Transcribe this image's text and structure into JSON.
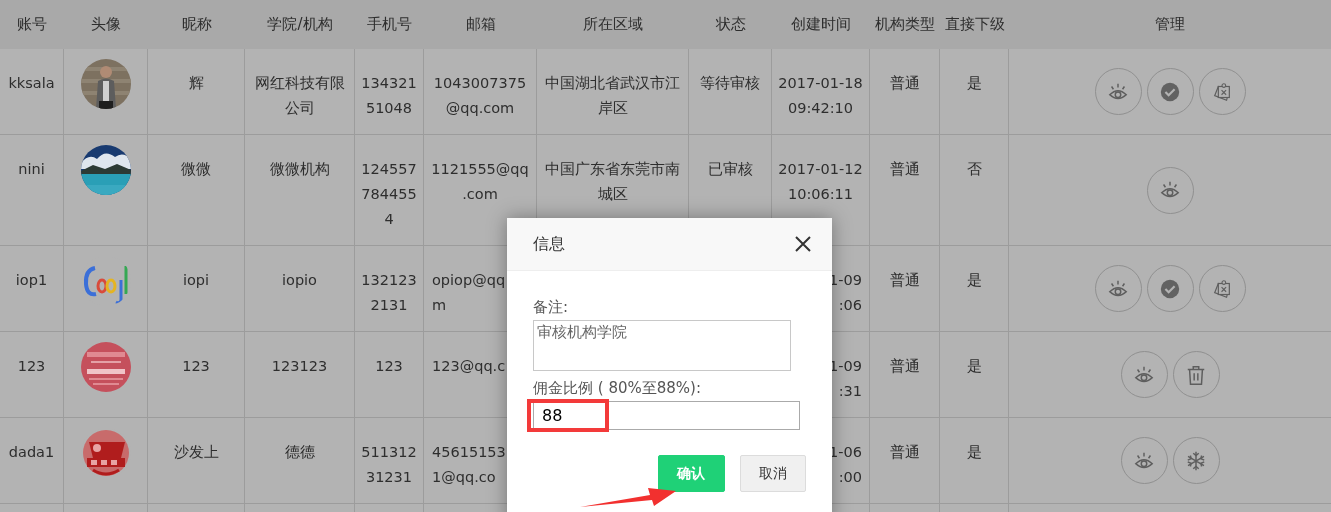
{
  "table": {
    "columns": [
      "账号",
      "头像",
      "昵称",
      "学院/机构",
      "手机号",
      "邮箱",
      "所在区域",
      "状态",
      "创建时间",
      "机构类型",
      "直接下级",
      "管理"
    ],
    "rows": [
      {
        "account": "kksala",
        "avatar": {
          "kind": "picture"
        },
        "nickname": "辉",
        "org": "网红科技有限公司",
        "phone": "134321\n51048",
        "email": "1043007375\n@qq.com",
        "region": "中国湖北省武汉市江岸区",
        "status": "等待审核",
        "created": "2017-01-18\n09:42:10",
        "org_type": "普通",
        "direct_sub": "是",
        "covered": false,
        "actions": [
          {
            "kind": "view"
          },
          {
            "kind": "approve"
          },
          {
            "kind": "reject"
          }
        ]
      },
      {
        "account": "nini",
        "avatar": {
          "kind": "picture"
        },
        "nickname": "微微",
        "org": "微微机构",
        "phone": "124557\n784455\n4",
        "email": "1121555@qq\n.com",
        "region": "中国广东省东莞市南城区",
        "status": "已审核",
        "created": "2017-01-12\n10:06:11",
        "org_type": "普通",
        "direct_sub": "否",
        "covered": false,
        "actions": [
          {
            "kind": "view"
          }
        ]
      },
      {
        "account": "iop1",
        "avatar": {
          "kind": "picture"
        },
        "nickname": "iopi",
        "org": "iopio",
        "phone": "132123\n2131",
        "email": "opiop@qq\nm",
        "created": "1-09\n:06",
        "org_type": "普通",
        "direct_sub": "是",
        "covered": true,
        "actions": [
          {
            "kind": "view"
          },
          {
            "kind": "approve"
          },
          {
            "kind": "reject"
          }
        ]
      },
      {
        "account": "123",
        "avatar": {
          "kind": "picture"
        },
        "nickname": "123",
        "org": "123123",
        "phone": "123",
        "email": "123@qq.c",
        "created": "1-09\n:31",
        "org_type": "普通",
        "direct_sub": "是",
        "covered": true,
        "actions": [
          {
            "kind": "view"
          },
          {
            "kind": "delete"
          }
        ]
      },
      {
        "account": "dada1",
        "avatar": {
          "kind": "picture"
        },
        "nickname": "沙发上",
        "org": "德德",
        "phone": "511312\n31231",
        "email": "45615153\n1@qq.co",
        "created": "1-06\n:00",
        "org_type": "普通",
        "direct_sub": "是",
        "covered": true,
        "actions": [
          {
            "kind": "view"
          },
          {
            "kind": "freeze"
          }
        ]
      }
    ]
  },
  "dialog": {
    "title": "信息",
    "fields": [
      {
        "kind": "textarea",
        "label": "备注:",
        "value": "审核机构学院",
        "highlighted": false
      },
      {
        "kind": "input",
        "label": "佣金比例 ( 80%至88%):",
        "value": "88",
        "highlighted": true
      }
    ],
    "buttons": [
      {
        "label": "确认",
        "kind": "primary"
      },
      {
        "label": "取消",
        "kind": "secondary"
      }
    ],
    "annotations": [
      {
        "kind": "arrow"
      }
    ]
  }
}
